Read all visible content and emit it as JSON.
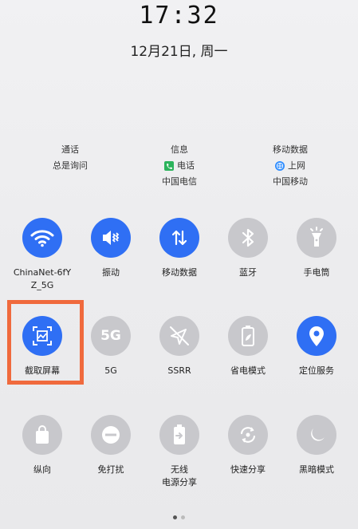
{
  "status": {
    "time": "17:32",
    "date": "12月21日, 周一"
  },
  "sim": {
    "calls": {
      "title": "通话",
      "value": "总是询问"
    },
    "sms": {
      "title": "信息",
      "value": "电话",
      "carrier": "中国电信"
    },
    "data": {
      "title": "移动数据",
      "value": "上网",
      "carrier": "中国移动"
    }
  },
  "tiles": {
    "row1": [
      {
        "id": "wifi",
        "label": "ChinaNet-6fY\nZ_5G",
        "state": "on",
        "icon": "wifi-icon"
      },
      {
        "id": "vibrate",
        "label": "振动",
        "state": "on",
        "icon": "vibrate-icon"
      },
      {
        "id": "mobile-data",
        "label": "移动数据",
        "state": "on",
        "icon": "data-arrows-icon"
      },
      {
        "id": "bluetooth",
        "label": "蓝牙",
        "state": "off",
        "icon": "bluetooth-icon"
      },
      {
        "id": "flashlight",
        "label": "手电筒",
        "state": "off",
        "icon": "flashlight-icon"
      }
    ],
    "row2": [
      {
        "id": "screenshot",
        "label": "截取屏幕",
        "state": "on",
        "icon": "screenshot-icon"
      },
      {
        "id": "5g",
        "label": "5G",
        "state": "off",
        "icon": "5g-icon"
      },
      {
        "id": "ssrr",
        "label": "SSRR",
        "state": "off",
        "icon": "ssrr-icon"
      },
      {
        "id": "power-saving",
        "label": "省电模式",
        "state": "off",
        "icon": "battery-leaf-icon"
      },
      {
        "id": "location",
        "label": "定位服务",
        "state": "on",
        "icon": "location-pin-icon"
      }
    ],
    "row3": [
      {
        "id": "portrait",
        "label": "纵向",
        "state": "off",
        "icon": "rotation-lock-icon"
      },
      {
        "id": "dnd",
        "label": "免打扰",
        "state": "off",
        "icon": "do-not-disturb-icon"
      },
      {
        "id": "wireless-share",
        "label": "无线\n电源分享",
        "state": "off",
        "icon": "battery-share-icon"
      },
      {
        "id": "quick-share",
        "label": "快速分享",
        "state": "off",
        "icon": "quick-share-icon"
      },
      {
        "id": "dark-mode",
        "label": "黑暗模式",
        "state": "off",
        "icon": "moon-icon"
      }
    ]
  },
  "colors": {
    "active": "#2f6ff4",
    "inactive": "#c8c8cc",
    "highlight": "#f06a3d"
  },
  "pager": {
    "pages": 2,
    "current": 1
  }
}
